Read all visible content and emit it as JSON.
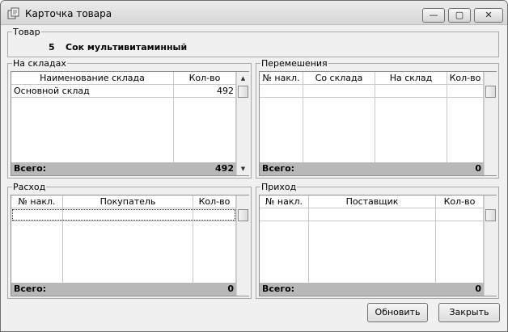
{
  "window": {
    "title": "Карточка товара",
    "min_glyph": "—",
    "max_glyph": "▢",
    "close_glyph": "✕"
  },
  "product": {
    "group_label": "Товар",
    "code": "5",
    "name": "Сок мультивитаминный"
  },
  "total_label": "Всего:",
  "warehouses": {
    "group_label": "На складах",
    "columns": [
      "Наименование склада",
      "Кол-во"
    ],
    "rows": [
      {
        "name": "Основной склад",
        "qty": "492"
      }
    ],
    "total": "492"
  },
  "movements": {
    "group_label": "Перемешения",
    "columns": [
      "№ накл.",
      "Со склада",
      "На склад",
      "Кол-во"
    ],
    "total": "0"
  },
  "expense": {
    "group_label": "Расход",
    "columns": [
      "№ накл.",
      "Покупатель",
      "Кол-во"
    ],
    "total": "0"
  },
  "income": {
    "group_label": "Приход",
    "columns": [
      "№ накл.",
      "Поставщик",
      "Кол-во"
    ],
    "total": "0"
  },
  "buttons": {
    "refresh": "Обновить",
    "close": "Закрыть"
  },
  "scroll": {
    "up": "▲",
    "down": "▼"
  }
}
